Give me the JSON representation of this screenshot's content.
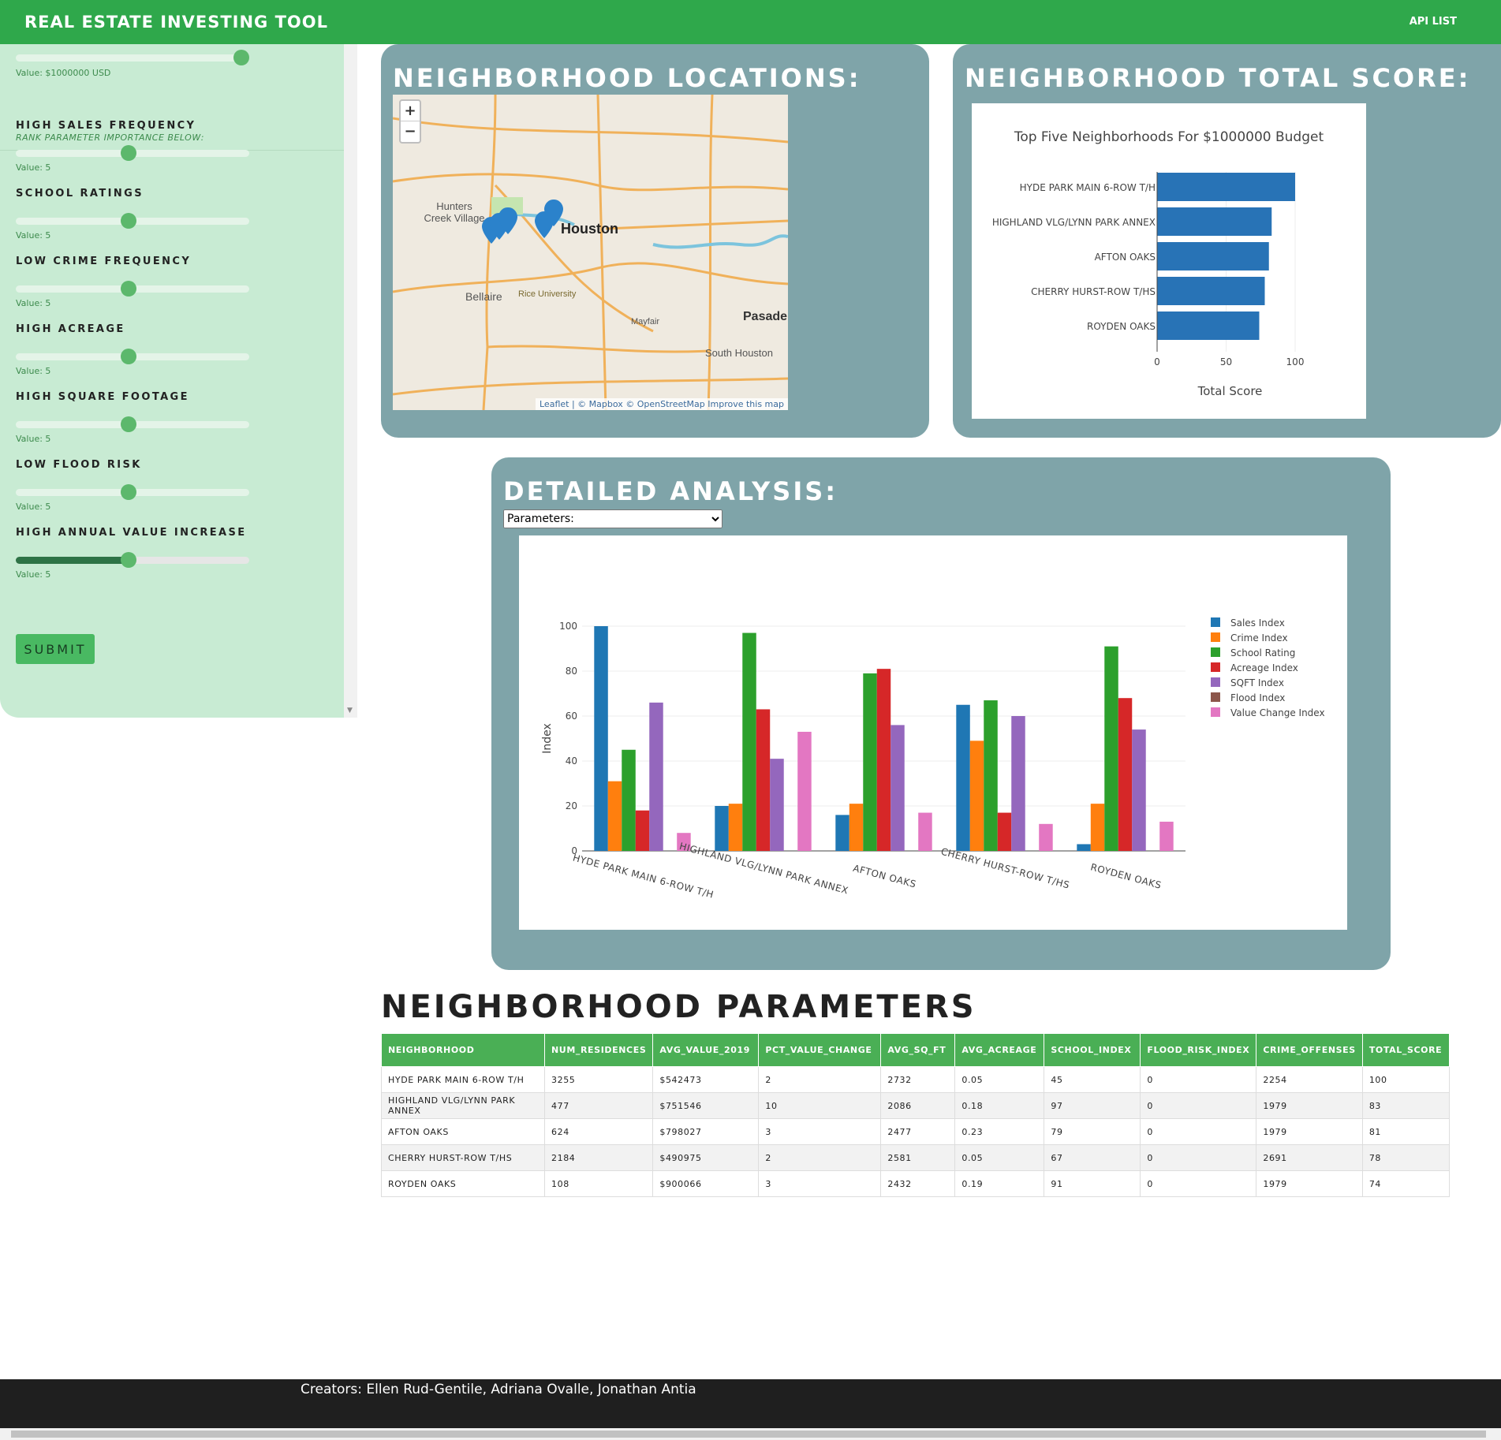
{
  "nav": {
    "brand": "REAL ESTATE INVESTING TOOL",
    "api_link": "API LIST"
  },
  "sidebar": {
    "budget_value": "Value: $1000000 USD",
    "budget_fraction": 1.0,
    "rank_hint": "RANK PARAMETER IMPORTANCE BELOW:",
    "sliders": [
      {
        "label": "HIGH SALES FREQUENCY",
        "value_text": "Value: 5",
        "value": 5
      },
      {
        "label": "SCHOOL RATINGS",
        "value_text": "Value: 5",
        "value": 5
      },
      {
        "label": "LOW CRIME FREQUENCY",
        "value_text": "Value: 5",
        "value": 5
      },
      {
        "label": "HIGH ACREAGE",
        "value_text": "Value: 5",
        "value": 5
      },
      {
        "label": "HIGH SQUARE FOOTAGE",
        "value_text": "Value: 5",
        "value": 5
      },
      {
        "label": "LOW FLOOD RISK",
        "value_text": "Value: 5",
        "value": 5
      },
      {
        "label": "HIGH ANNUAL VALUE INCREASE",
        "value_text": "Value: 5",
        "value": 5
      }
    ],
    "submit_label": "SUBMIT"
  },
  "map_panel": {
    "title": "NEIGHBORHOOD LOCATIONS:",
    "zoom_in": "+",
    "zoom_out": "−",
    "attribution": "Leaflet | © Mapbox © OpenStreetMap Improve this map",
    "labels": [
      "Hunters Creek Village",
      "Houston",
      "Bellaire",
      "Rice University",
      "Mayfair",
      "Pasade",
      "South Houston"
    ]
  },
  "score_panel": {
    "title": "NEIGHBORHOOD TOTAL SCORE:"
  },
  "detail_panel": {
    "title": "DETAILED ANALYSIS:",
    "select_value": "Parameters:"
  },
  "table": {
    "title": "NEIGHBORHOOD PARAMETERS",
    "headers": [
      "NEIGHBORHOOD",
      "NUM_RESIDENCES",
      "AVG_VALUE_2019",
      "PCT_VALUE_CHANGE",
      "AVG_SQ_FT",
      "AVG_ACREAGE",
      "SCHOOL_INDEX",
      "FLOOD_RISK_INDEX",
      "CRIME_OFFENSES",
      "TOTAL_SCORE"
    ],
    "rows": [
      [
        "HYDE PARK MAIN 6-ROW T/H",
        "3255",
        "$542473",
        "2",
        "2732",
        "0.05",
        "45",
        "0",
        "2254",
        "100"
      ],
      [
        "HIGHLAND VLG/LYNN PARK ANNEX",
        "477",
        "$751546",
        "10",
        "2086",
        "0.18",
        "97",
        "0",
        "1979",
        "83"
      ],
      [
        "AFTON OAKS",
        "624",
        "$798027",
        "3",
        "2477",
        "0.23",
        "79",
        "0",
        "1979",
        "81"
      ],
      [
        "CHERRY HURST-ROW T/HS",
        "2184",
        "$490975",
        "2",
        "2581",
        "0.05",
        "67",
        "0",
        "2691",
        "78"
      ],
      [
        "ROYDEN OAKS",
        "108",
        "$900066",
        "3",
        "2432",
        "0.19",
        "91",
        "0",
        "1979",
        "74"
      ]
    ]
  },
  "footer": {
    "text": "Creators: Ellen Rud-Gentile, Adriana Ovalle, Jonathan Antia"
  },
  "chart_data": [
    {
      "type": "bar",
      "orientation": "horizontal",
      "title": "Top Five Neighborhoods For $1000000 Budget",
      "xlabel": "Total Score",
      "ylabel": "",
      "categories": [
        "HYDE PARK MAIN 6-ROW T/H",
        "HIGHLAND VLG/LYNN PARK ANNEX",
        "AFTON OAKS",
        "CHERRY HURST-ROW T/HS",
        "ROYDEN OAKS"
      ],
      "values": [
        100,
        83,
        81,
        78,
        74
      ],
      "xlim": [
        0,
        100
      ],
      "xticks": [
        0,
        50,
        100
      ],
      "color": "#2873b6"
    },
    {
      "type": "bar",
      "title": "",
      "xlabel": "",
      "ylabel": "Index",
      "ylim": [
        0,
        100
      ],
      "yticks": [
        0,
        20,
        40,
        60,
        80,
        100
      ],
      "grid": true,
      "legend": "right",
      "categories": [
        "HYDE PARK MAIN 6-ROW T/H",
        "HIGHLAND VLG/LYNN PARK ANNEX",
        "AFTON OAKS",
        "CHERRY HURST-ROW T/HS",
        "ROYDEN OAKS"
      ],
      "series": [
        {
          "name": "Sales Index",
          "color": "#1f77b4",
          "values": [
            100,
            20,
            16,
            65,
            3
          ]
        },
        {
          "name": "Crime Index",
          "color": "#ff7f0e",
          "values": [
            31,
            21,
            21,
            49,
            21
          ]
        },
        {
          "name": "School Rating",
          "color": "#2ca02c",
          "values": [
            45,
            97,
            79,
            67,
            91
          ]
        },
        {
          "name": "Acreage Index",
          "color": "#d62728",
          "values": [
            18,
            63,
            81,
            17,
            68
          ]
        },
        {
          "name": "SQFT Index",
          "color": "#9467bd",
          "values": [
            66,
            41,
            56,
            60,
            54
          ]
        },
        {
          "name": "Flood Index",
          "color": "#8c564b",
          "values": [
            0,
            0,
            0,
            0,
            0
          ]
        },
        {
          "name": "Value Change Index",
          "color": "#e377c2",
          "values": [
            8,
            53,
            17,
            12,
            13
          ]
        }
      ]
    }
  ]
}
